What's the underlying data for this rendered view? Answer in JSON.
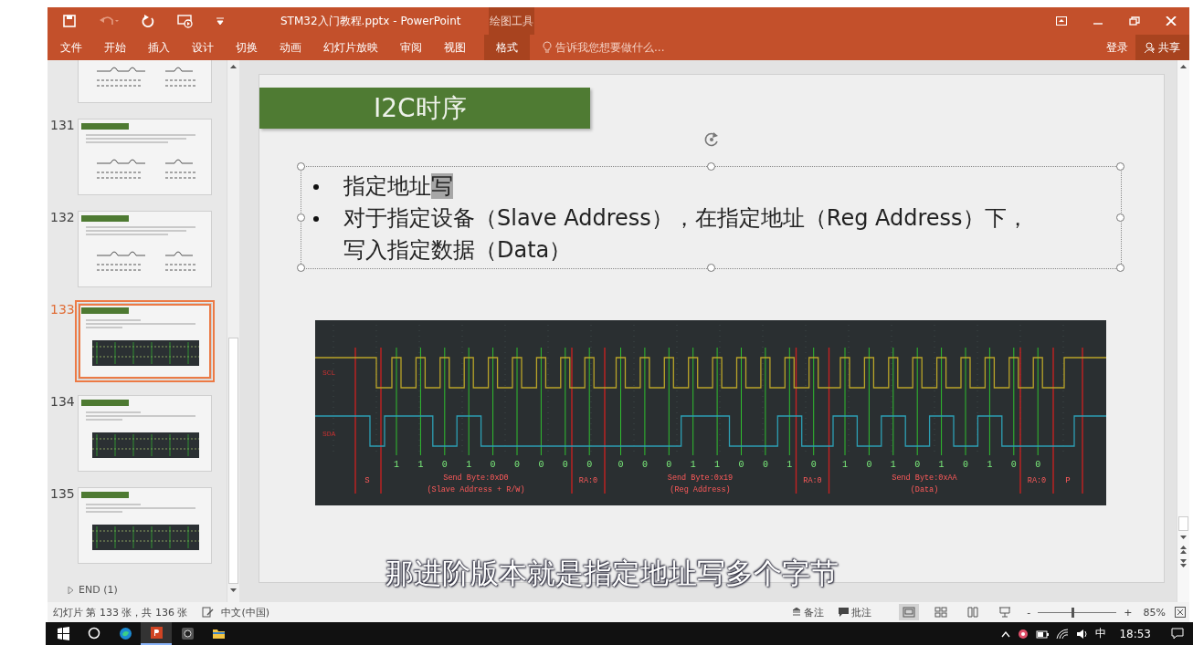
{
  "title_bar": {
    "title": "STM32入门教程.pptx - PowerPoint",
    "context_group": "绘图工具"
  },
  "ribbon": {
    "tabs": [
      {
        "label": "文件",
        "selected": false
      },
      {
        "label": "开始",
        "selected": false
      },
      {
        "label": "插入",
        "selected": false
      },
      {
        "label": "设计",
        "selected": false
      },
      {
        "label": "切换",
        "selected": false
      },
      {
        "label": "动画",
        "selected": false
      },
      {
        "label": "幻灯片放映",
        "selected": false
      },
      {
        "label": "审阅",
        "selected": false
      },
      {
        "label": "视图",
        "selected": false
      },
      {
        "label": "格式",
        "selected": true
      }
    ],
    "tell_me": {
      "placeholder": "告诉我您想要做什么..."
    },
    "sign_in": "登录",
    "share": "共享"
  },
  "thumbnails": [
    {
      "number": "131",
      "kind": "diagram",
      "selected": false
    },
    {
      "number": "132",
      "kind": "diagram",
      "selected": false
    },
    {
      "number": "133",
      "kind": "capture",
      "selected": true
    },
    {
      "number": "134",
      "kind": "capture",
      "selected": false
    },
    {
      "number": "135",
      "kind": "capture",
      "selected": false
    }
  ],
  "section": {
    "label": "END (1)",
    "expanded": false
  },
  "slide": {
    "title": "I2C时序",
    "bullets": [
      {
        "lines": [
          [
            {
              "text": "指定地址",
              "highlighted": false
            },
            {
              "text": "写",
              "highlighted": true
            }
          ]
        ]
      },
      {
        "lines": [
          [
            {
              "text": "对于指定设备（Slave Address），在指定地址（Reg Address）下，",
              "highlighted": false
            }
          ],
          [
            {
              "text": "写入指定数据（Data）",
              "highlighted": false
            }
          ]
        ]
      }
    ],
    "capture": {
      "channels": [
        {
          "label": "SCL"
        },
        {
          "label": "SDA"
        }
      ],
      "start_label": "S",
      "stop_label": "P",
      "bytes": [
        {
          "bits": [
            "1",
            "1",
            "0",
            "1",
            "0",
            "0",
            "0",
            "0"
          ],
          "ack": "0",
          "title": "Send Byte:0xD0",
          "subtitle": "(Slave Address + R/W)",
          "ack_label": "RA:0"
        },
        {
          "bits": [
            "0",
            "0",
            "0",
            "1",
            "1",
            "0",
            "0",
            "1"
          ],
          "ack": "0",
          "title": "Send Byte:0x19",
          "subtitle": "(Reg Address)",
          "ack_label": "RA:0"
        },
        {
          "bits": [
            "1",
            "0",
            "1",
            "0",
            "1",
            "0",
            "1",
            "0"
          ],
          "ack": "0",
          "title": "Send Byte:0xAA",
          "subtitle": "(Data)",
          "ack_label": "RA:0"
        }
      ]
    }
  },
  "subtitle": "那进阶版本就是指定地址写多个字节",
  "status_bar": {
    "slide_info": "幻灯片 第 133 张，共 136 张",
    "language": "中文(中国)",
    "notes": "备注",
    "comments": "批注",
    "views": [
      {
        "kind": "normal",
        "selected": true
      },
      {
        "kind": "sorter",
        "selected": false
      },
      {
        "kind": "reading",
        "selected": false
      },
      {
        "kind": "slideshow",
        "selected": false
      }
    ],
    "zoom_out": "-",
    "zoom_in": "+",
    "zoom": {
      "level": 0.44,
      "reading": "85%"
    }
  },
  "taskbar": {
    "apps": [
      {
        "kind": "start",
        "selected": false
      },
      {
        "kind": "search",
        "selected": false
      },
      {
        "kind": "edge",
        "selected": false
      },
      {
        "kind": "powerpoint",
        "selected": true
      },
      {
        "kind": "camera",
        "selected": false
      },
      {
        "kind": "folder",
        "selected": false
      }
    ],
    "ime": "中",
    "time": "18:53"
  }
}
